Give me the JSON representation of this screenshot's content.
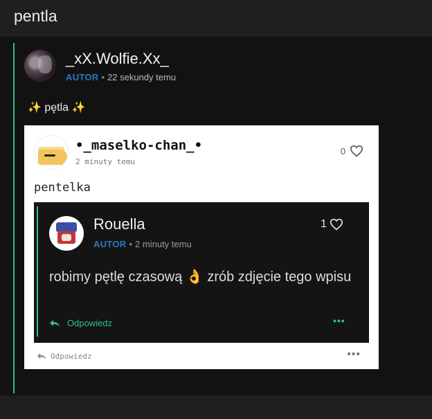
{
  "page": {
    "title": "pentla"
  },
  "post": {
    "username": "_xX.Wolfie.Xx_",
    "author_badge": "AUTOR",
    "time": "22 sekundy temu",
    "text_sparkle_left": "✨",
    "text": " pętla ",
    "text_sparkle_right": "✨"
  },
  "embedded": {
    "username": "•_maselko-chan_•",
    "time": "2 minuty temu",
    "likes": "0",
    "text": "pentelka",
    "reply_label": "Odpowiedz",
    "more_label": "•••",
    "nested": {
      "username": "Rouella",
      "author_badge": "AUTOR",
      "time": "2 minuty temu",
      "likes": "1",
      "text_before": "robimy pętlę czasową ",
      "emoji": "👌",
      "text_after": " zrób zdjęcie tego wpisu",
      "reply_label": "Odpowiedz",
      "more_label": "•••"
    }
  },
  "colors": {
    "accent_green": "#2fbd98",
    "author_blue": "#2b78c2",
    "background": "#1f1f1f",
    "card": "#121212"
  },
  "icons": [
    "heart-icon",
    "reply-arrow-icon",
    "more-options-icon",
    "sparkles-icon",
    "ok-hand-icon"
  ]
}
